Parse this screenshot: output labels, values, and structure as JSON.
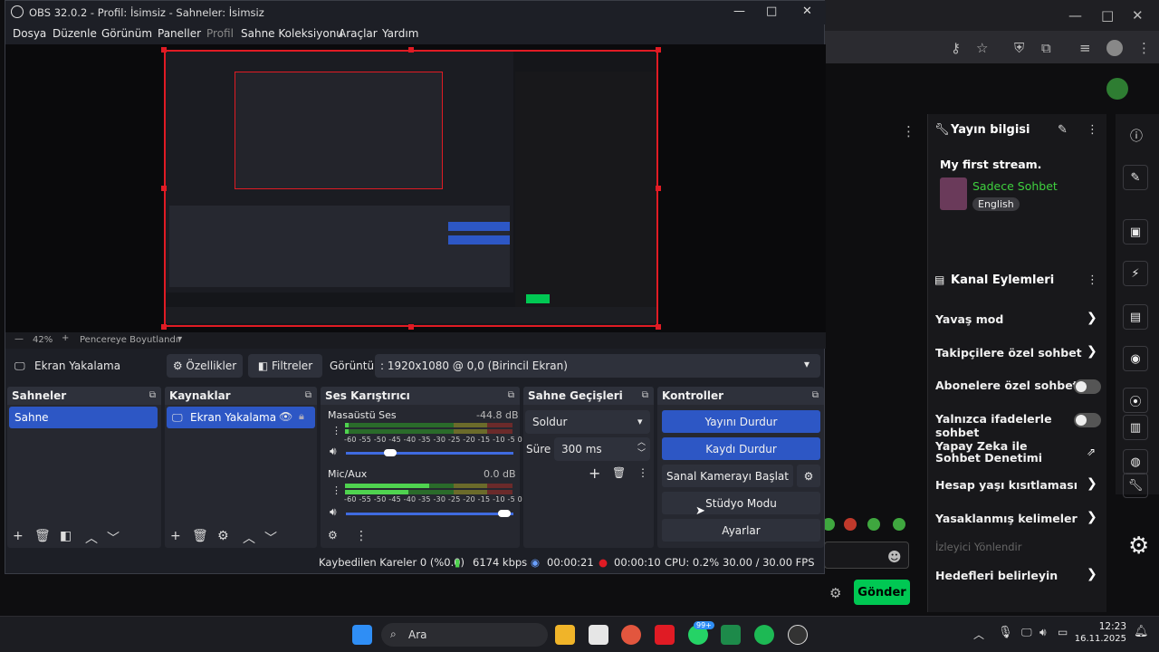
{
  "browser": {
    "stream_info_title": "Yayın bilgisi",
    "stream_title": "My first stream.",
    "channel_name": "Sadece Sohbet",
    "language": "English",
    "channel_actions_title": "Kanal Eylemleri",
    "actions": [
      {
        "label": "Yavaş mod",
        "control": "chevron"
      },
      {
        "label": "Takipçilere özel sohbet",
        "control": "chevron"
      },
      {
        "label": "Abonelere özel sohbet",
        "control": "toggle"
      },
      {
        "label": "Yalnızca ifadelerle sohbet",
        "control": "toggle"
      },
      {
        "label": "Yapay Zeka ile Sohbet Denetimi",
        "control": "external"
      },
      {
        "label": "Hesap yaşı kısıtlaması",
        "control": "chevron"
      },
      {
        "label": "Yasaklanmış kelimeler",
        "control": "chevron"
      },
      {
        "label": "İzleyici Yönlendir",
        "control": "none"
      },
      {
        "label": "Hedefleri belirleyin",
        "control": "chevron"
      }
    ],
    "send_button": "Gönder"
  },
  "obs": {
    "title": "OBS 32.0.2 - Profil: İsimsiz - Sahneler: İsimsiz",
    "menu": [
      "Dosya",
      "Düzenle",
      "Görünüm",
      "Paneller",
      "Profil",
      "Sahne Koleksiyonu",
      "Araçlar",
      "Yardım"
    ],
    "zoom": "42%",
    "fit_label": "Pencereye Boyutlandır",
    "source_label": "Ekran Yakalama",
    "properties_button": "Özellikler",
    "filters_button": "Filtreler",
    "display_label": "Görüntü",
    "display_value": ": 1920x1080 @ 0,0 (Birincil Ekran)",
    "docks": {
      "scenes": {
        "title": "Sahneler",
        "items": [
          "Sahne"
        ]
      },
      "sources": {
        "title": "Kaynaklar",
        "items": [
          "Ekran Yakalama"
        ]
      },
      "mixer": {
        "title": "Ses Karıştırıcı",
        "channels": [
          {
            "name": "Masaüstü Ses",
            "db": "-44.8 dB",
            "level": 0.02,
            "volume": 0.3
          },
          {
            "name": "Mic/Aux",
            "db": "0.0 dB",
            "level": 0.5,
            "volume": 1.0
          }
        ],
        "scale": "-60 -55 -50 -45 -40 -35 -30 -25 -20 -15 -10 -5 0"
      },
      "transitions": {
        "title": "Sahne Geçişleri",
        "transition": "Soldur",
        "duration_label": "Süre",
        "duration": "300 ms"
      },
      "controls": {
        "title": "Kontroller",
        "buttons": [
          "Yayını Durdur",
          "Kaydı Durdur",
          "Sanal Kamerayı Başlat",
          "Stüdyo Modu",
          "Ayarlar"
        ]
      }
    },
    "status": {
      "dropped": "Kaybedilen Kareler 0 (%0.0)",
      "bitrate": "6174 kbps",
      "stream_time": "00:00:21",
      "rec_time": "00:00:10",
      "cpu": "CPU: 0.2%",
      "fps": "30.00 / 30.00 FPS"
    }
  },
  "taskbar": {
    "search": "Ara",
    "time": "12:23",
    "date": "16.11.2025",
    "badge": "99+"
  }
}
